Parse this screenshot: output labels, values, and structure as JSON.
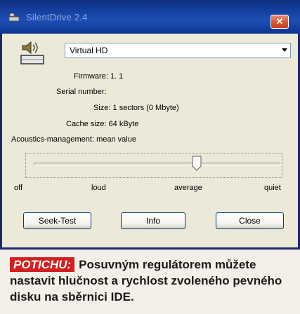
{
  "window": {
    "title": "SilentDrive 2.4",
    "close_symbol": "✕"
  },
  "drive_select": {
    "value": "Virtual HD"
  },
  "info": {
    "firmware_label": "Firmware:",
    "firmware_value": "1. 1",
    "serial_label": "Serial number:",
    "serial_value": "",
    "size_label": "Size:",
    "size_value": "1 sectors (0 Mbyte)",
    "cache_label": "Cache size:",
    "cache_value": "64 kByte",
    "acoustics_label": "Acoustics-management:",
    "acoustics_value": "mean value"
  },
  "slider": {
    "level_fraction": 0.66,
    "labels": [
      "off",
      "loud",
      "average",
      "quiet"
    ]
  },
  "buttons": {
    "seek_test": "Seek-Test",
    "info": "Info",
    "close": "Close"
  },
  "caption": {
    "tag": "POTICHU:",
    "text": "Posuvným regulátorem můžete nastavit hlučnost a rychlost zvoleného pevného disku na sběrnici IDE."
  },
  "colors": {
    "titlebar": "#153f9e",
    "close_button": "#d5542e",
    "caption_tag": "#d31f1f"
  },
  "icons": [
    "app-icon",
    "drive-speaker-icon",
    "close-icon",
    "chevron-down-icon",
    "slider-thumb-icon"
  ]
}
